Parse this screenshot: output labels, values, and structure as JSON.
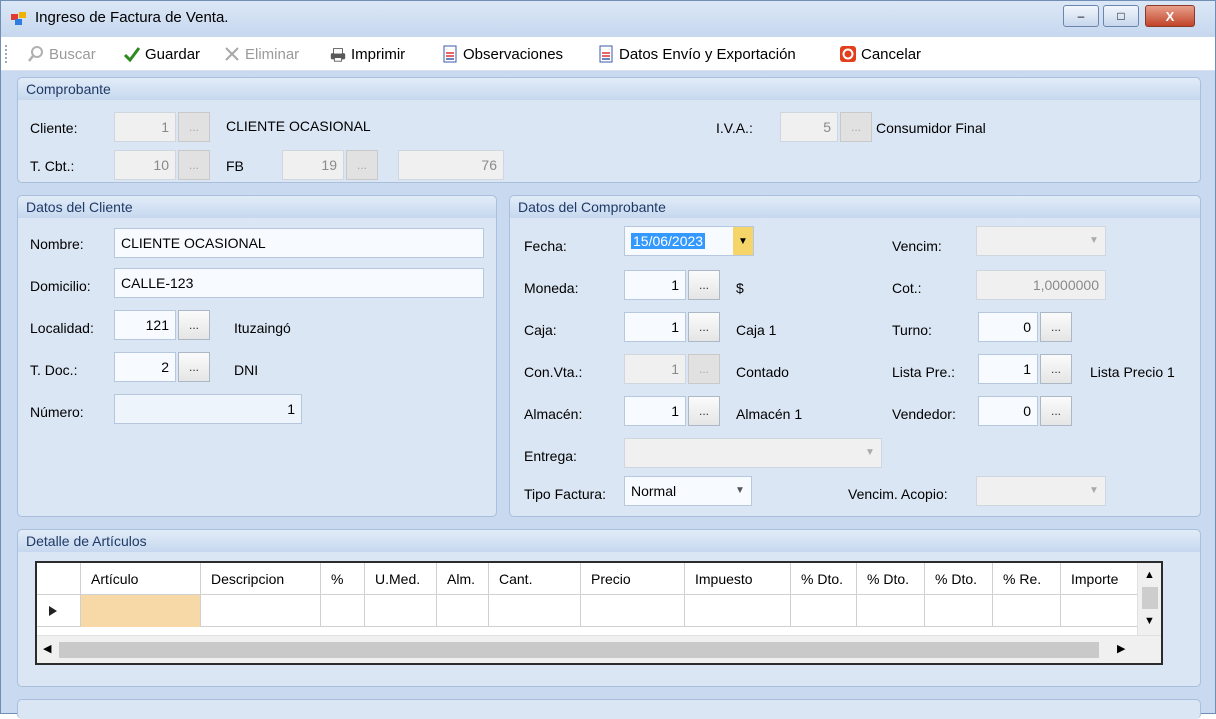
{
  "window": {
    "title": "Ingreso de Factura de Venta.",
    "minimize": "–",
    "maximize": "□",
    "close": "X"
  },
  "toolbar": {
    "buscar": "Buscar",
    "guardar": "Guardar",
    "eliminar": "Eliminar",
    "imprimir": "Imprimir",
    "observaciones": "Observaciones",
    "datos_envio": "Datos Envío y Exportación",
    "cancelar": "Cancelar"
  },
  "comprobante": {
    "header": "Comprobante",
    "cliente_label": "Cliente:",
    "cliente_code": "1",
    "cliente_name": "CLIENTE OCASIONAL",
    "iva_label": "I.V.A.:",
    "iva_code": "5",
    "iva_name": "Consumidor Final",
    "tcbt_label": "T. Cbt.:",
    "tcbt_code": "10",
    "tcbt_name": "FB",
    "punto_venta": "19",
    "numero": "76",
    "dots": "..."
  },
  "cliente": {
    "header": "Datos del Cliente",
    "nombre_label": "Nombre:",
    "nombre": "CLIENTE OCASIONAL",
    "domicilio_label": "Domicilio:",
    "domicilio": "CALLE-123",
    "localidad_label": "Localidad:",
    "localidad_code": "121",
    "localidad_name": "Ituzaingó",
    "tdoc_label": "T. Doc.:",
    "tdoc_code": "2",
    "tdoc_name": "DNI",
    "numero_label": "Número:",
    "numero": "1",
    "dots": "..."
  },
  "datos_comprobante": {
    "header": "Datos del Comprobante",
    "fecha_label": "Fecha:",
    "fecha": "15/06/2023",
    "vencim_label": "Vencim:",
    "moneda_label": "Moneda:",
    "moneda_code": "1",
    "moneda_name": "$",
    "cot_label": "Cot.:",
    "cot": "1,0000000",
    "caja_label": "Caja:",
    "caja_code": "1",
    "caja_name": "Caja 1",
    "turno_label": "Turno:",
    "turno": "0",
    "convta_label": "Con.Vta.:",
    "convta_code": "1",
    "convta_name": "Contado",
    "lista_label": "Lista Pre.:",
    "lista_code": "1",
    "lista_name": "Lista Precio 1",
    "almacen_label": "Almacén:",
    "almacen_code": "1",
    "almacen_name": "Almacén 1",
    "vendedor_label": "Vendedor:",
    "vendedor": "0",
    "entrega_label": "Entrega:",
    "tipo_factura_label": "Tipo Factura:",
    "tipo_factura": "Normal",
    "vencim_acopio_label": "Vencim. Acopio:",
    "dots": "..."
  },
  "detalle": {
    "header": "Detalle de Artículos",
    "columns": [
      "Artículo",
      "Descripcion",
      "%",
      "U.Med.",
      "Alm.",
      "Cant.",
      "Precio",
      "Impuesto",
      "% Dto.",
      "% Dto.",
      "% Dto.",
      "% Re.",
      "Importe"
    ]
  },
  "colors": {
    "window_bg": "#c9d9ef",
    "group_bg": "#dbe6f4",
    "header_text": "#1f3a66",
    "selection": "#3399ff",
    "active_cell": "#f7d9a8"
  }
}
